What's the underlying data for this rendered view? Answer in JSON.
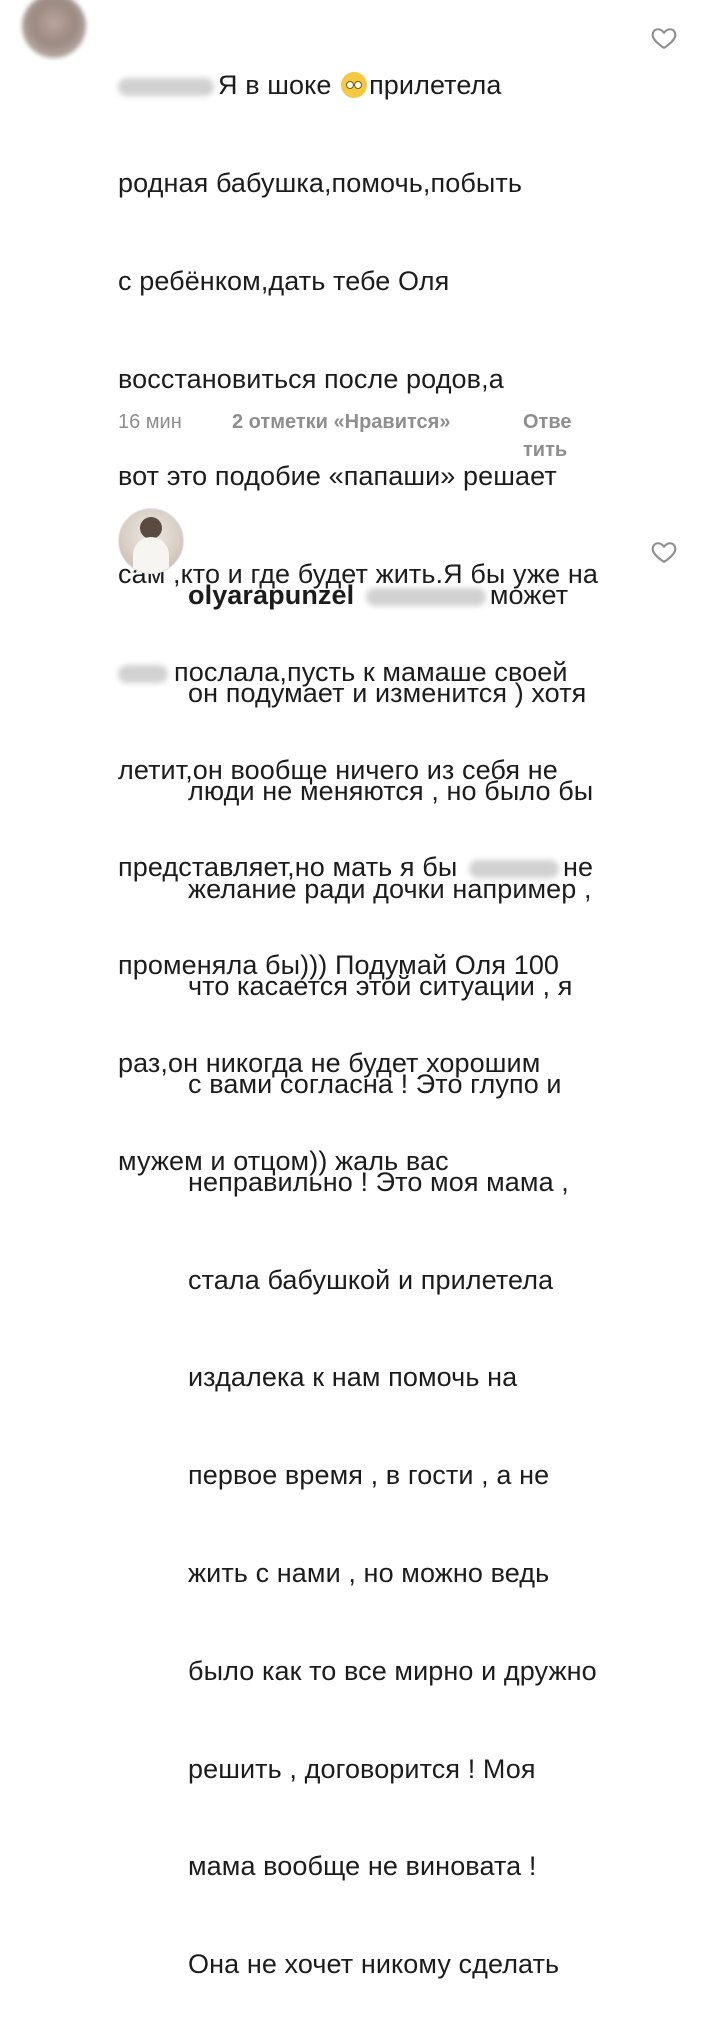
{
  "comments": [
    {
      "avatar": "blurred-avatar",
      "username_hidden": true,
      "lines": [
        "Я в шоке",
        "прилетела",
        "родная бабушка,помочь,побыть",
        "с ребёнком,дать тебе Оля",
        "восстановиться после родов,а",
        "вот это подобие «папаши» решает",
        "сам ,кто и где будет жить.Я бы уже на",
        "послала,пусть к мамаше своей",
        "летит,он вообще ничего из себя не",
        "представляет,но мать я бы",
        "не",
        "променяла бы))) Подумай Оля 100",
        "раз,он никогда не будет хорошим",
        "мужем и отцом)) жаль вас"
      ],
      "time": "16 мин",
      "likes": "2 отметки «Нравится»",
      "reply_line1": "Отве",
      "reply_line2": "тить"
    },
    {
      "avatar": "user-avatar",
      "username": "olyarapunzel",
      "lines": [
        "может",
        "он подумает и изменится ) хотя",
        "люди не меняются , но было бы",
        "желание ради дочки например ,",
        "что касается этой ситуации , я",
        "с вами согласна ! Это глупо и",
        "неправильно ! Это моя мама ,",
        "стала бабушкой и прилетела",
        "издалека к нам помочь на",
        "первое время , в гости , а не",
        "жить с нами , но можно ведь",
        "было как то все мирно и дружно",
        "решить , договорится ! Моя",
        "мама вообще не виновата !",
        "Она не хочет никому сделать"
      ]
    }
  ],
  "icons": {
    "like": "heart-outline-icon",
    "emoji": "flushed-face-emoji"
  },
  "colors": {
    "text": "#1c1c1c",
    "meta": "#8e8e8e",
    "background": "#ffffff"
  }
}
